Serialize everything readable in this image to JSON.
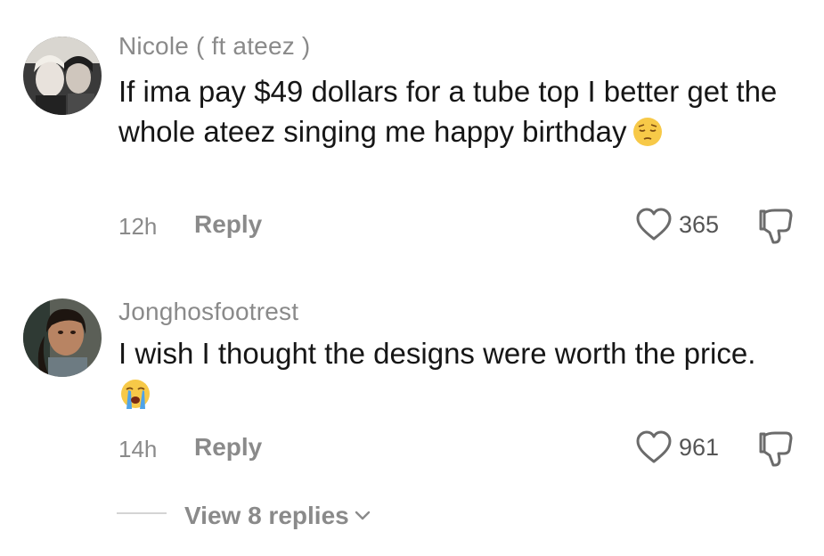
{
  "comments": [
    {
      "username": "Nicole ( ft ateez )",
      "text": "If ima pay $49 dollars for a tube top I better get the whole ateez singing me happy birthday",
      "emoji": "pensive-face-emoji",
      "time": "12h",
      "reply_label": "Reply",
      "likes": "365"
    },
    {
      "username": "Jonghosfootrest",
      "text": "I wish I thought the designs were worth the price.",
      "emoji": "loudly-crying-face-emoji",
      "time": "14h",
      "reply_label": "Reply",
      "likes": "961"
    }
  ],
  "view_replies": "View 8 replies",
  "icons": {
    "like": "heart-outline-icon",
    "dislike": "thumbs-down-outline-icon",
    "expand": "chevron-down-icon"
  }
}
